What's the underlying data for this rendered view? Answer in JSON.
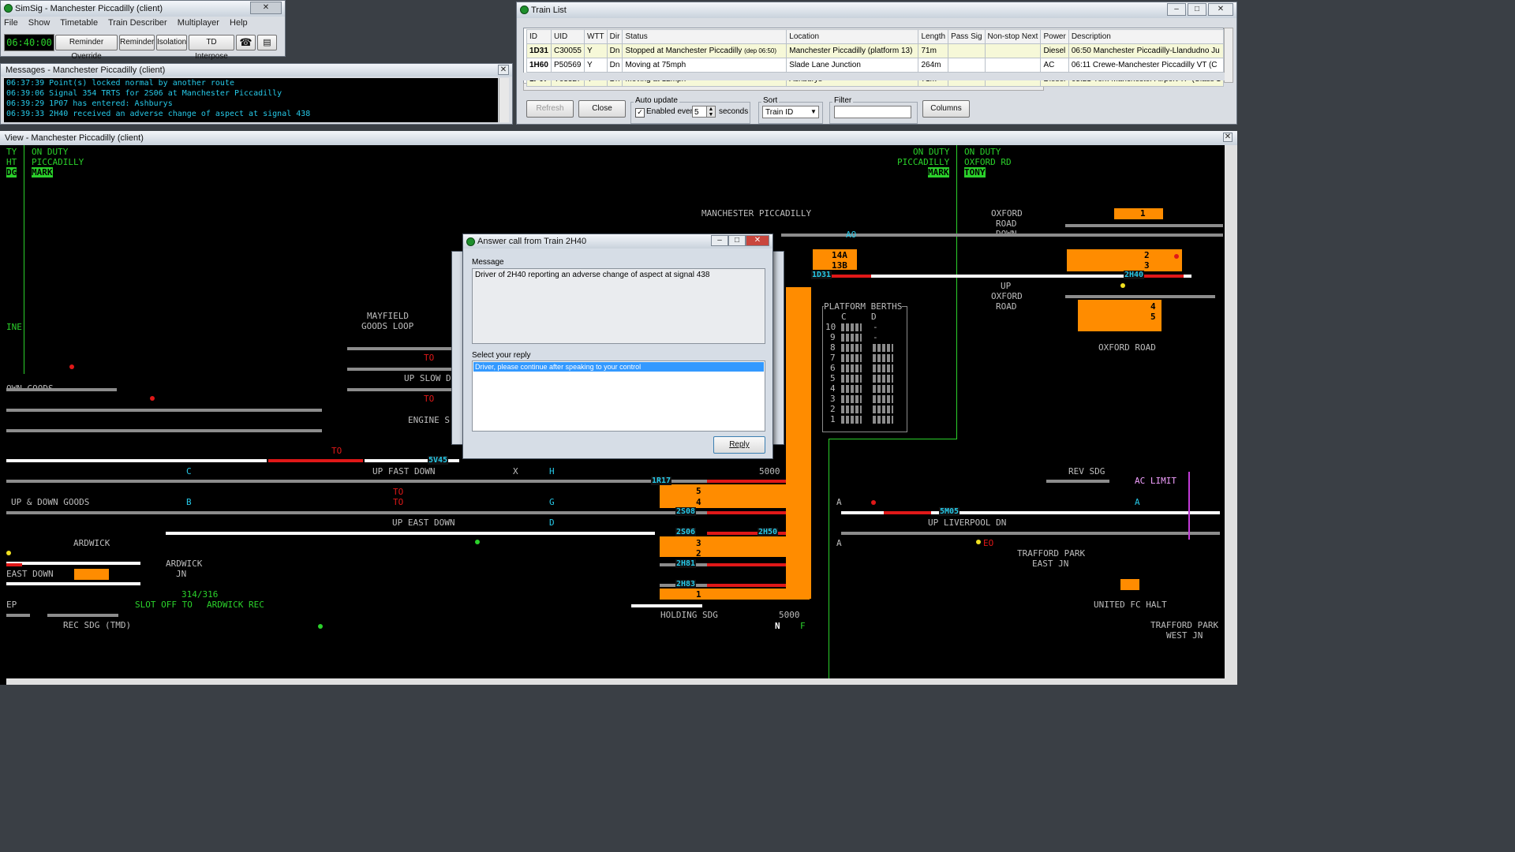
{
  "main_window": {
    "title": "SimSig - Manchester Piccadilly (client)",
    "menu": [
      "File",
      "Show",
      "Timetable",
      "Train Describer",
      "Multiplayer",
      "Help"
    ],
    "clock": "06:40:00",
    "buttons": [
      "Reminder Override",
      "Reminder",
      "Isolation",
      "TD Interpose"
    ],
    "icons": [
      "telephone-icon",
      "printer-icon"
    ]
  },
  "messages": {
    "title": "Messages - Manchester Piccadilly (client)",
    "lines": [
      "06:37:39 Point(s) locked normal by another route",
      "06:39:06 Signal 354 TRTS for 2S06 at Manchester Piccadilly",
      "06:39:29 1P07 has entered: Ashburys",
      "06:39:33 2H40 received an adverse change of aspect at signal 438"
    ]
  },
  "train_list": {
    "title": "Train List",
    "columns": [
      "ID",
      "UID",
      "WTT",
      "Dir",
      "Status",
      "Location",
      "Length",
      "Pass Sig",
      "Non-stop Next",
      "Power",
      "Description"
    ],
    "rows": [
      {
        "id": "1D31",
        "uid": "C30055",
        "wtt": "Y",
        "dir": "Dn",
        "status": "Stopped at Manchester Piccadilly",
        "status_note": "(dep 06:50)",
        "location": "Manchester Piccadilly (platform 13)",
        "length": "71m",
        "pass_sig": "",
        "nonstop": "",
        "power": "Diesel",
        "description": "06:50 Manchester Piccadilly-Llandudno Ju"
      },
      {
        "id": "1H60",
        "uid": "P50569",
        "wtt": "Y",
        "dir": "Dn",
        "status": "Moving at 75mph",
        "status_note": "",
        "location": "Slade Lane Junction",
        "length": "264m",
        "pass_sig": "",
        "nonstop": "",
        "power": "AC",
        "description": "06:11 Crewe-Manchester Piccadilly VT (C"
      },
      {
        "id": "1P07",
        "uid": "Y63327",
        "wtt": "Y",
        "dir": "Dn",
        "status": "Moving at 12mph",
        "status_note": "",
        "location": "Ashburys",
        "length": "71m",
        "pass_sig": "",
        "nonstop": "",
        "power": "Diesel",
        "description": "05:21 York-Manchester Airport TP (Class 1"
      }
    ],
    "refresh_label": "Refresh",
    "close_label": "Close",
    "auto_update_label": "Auto update",
    "enabled_label": "Enabled every",
    "interval": "5",
    "seconds_label": "seconds",
    "sort_label": "Sort",
    "sort_value": "Train ID",
    "filter_label": "Filter",
    "filter_value": "",
    "columns_label": "Columns"
  },
  "view": {
    "title": "View - Manchester Piccadilly (client)",
    "labels": {
      "top_left_a": "TY",
      "top_left_b": "HT",
      "top_left_c": "DG",
      "on_duty": "ON DUTY",
      "piccadilly": "PICCADILLY",
      "mark": "MARK",
      "oxford_rd": "OXFORD RD",
      "tony": "TONY",
      "manchester_piccadilly": "MANCHESTER PICCADILLY",
      "oxford_road": "OXFORD ROAD",
      "oxford": "OXFORD",
      "road": "ROAD",
      "down": "DOWN",
      "up": "UP",
      "platform_berths": "PLATFORM BERTHS",
      "berth_c": "C",
      "berth_d": "D",
      "berth_nums": [
        "10",
        "9",
        "8",
        "7",
        "6",
        "5",
        "4",
        "3",
        "2",
        "1"
      ],
      "berth_dash": "-",
      "mayfield": "MAYFIELD",
      "goods_loop": "GOODS LOOP",
      "up_slow_down": "UP SLOW DO",
      "engine_s": "ENGINE S",
      "up_fast_down": "UP FAST DOWN",
      "up_east_down": "UP EAST DOWN",
      "own_goods": "OWN GOODS",
      "up_down_goods": "UP & DOWN GOODS",
      "ine": "INE",
      "ardwick": "ARDWICK",
      "ardwick_jn": "ARDWICK",
      "jn": "JN",
      "east_down": "EAST DOWN",
      "ep": "EP",
      "slot_num": "314/316",
      "slot_off": "SLOT OFF TO",
      "ardwick_rec": "ARDWICK REC",
      "rec_sdg": "REC SDG (TMD)",
      "holding_sdg": "HOLDING SDG",
      "n5000a": "5000",
      "n5000b": "5000",
      "no": "N",
      "f": "F",
      "rev_sdg": "REV SDG",
      "ac_limit": "AC LIMIT",
      "up_liverpool": "UP LIVERPOOL DN",
      "trafford_park": "TRAFFORD PARK",
      "east_jn": "EAST JN",
      "united_fc": "UNITED FC HALT",
      "trafford_park_w": "TRAFFORD PARK",
      "west_jn": "WEST JN",
      "to": "TO",
      "x": "X",
      "a": "A"
    },
    "berths": [
      "1D31",
      "2H40",
      "5V45",
      "1R17",
      "2S08",
      "2S06",
      "2H50",
      "2H81",
      "2H83",
      "5M05"
    ],
    "platforms": [
      "14A",
      "13B",
      "1",
      "2",
      "3",
      "4",
      "5",
      "5",
      "4",
      "3",
      "2",
      "1"
    ],
    "signal_ids": [
      "A",
      "B",
      "C",
      "D",
      "G",
      "H",
      "AO",
      "EO"
    ]
  },
  "answer_dialog": {
    "title": "Answer call from Train 2H40",
    "message_label": "Message",
    "message": "Driver of 2H40 reporting an adverse change of aspect at signal 438",
    "reply_label": "Select your reply",
    "options": [
      "Driver, please continue after speaking to your control"
    ],
    "reply_button": "Reply"
  },
  "colors": {
    "track": "#8c8c8c",
    "route_set": "#ffffff",
    "occupied": "#e01818",
    "platform": "#ff8c00",
    "berth_text": "#26c9e8",
    "on_duty": "#2bd12b"
  }
}
